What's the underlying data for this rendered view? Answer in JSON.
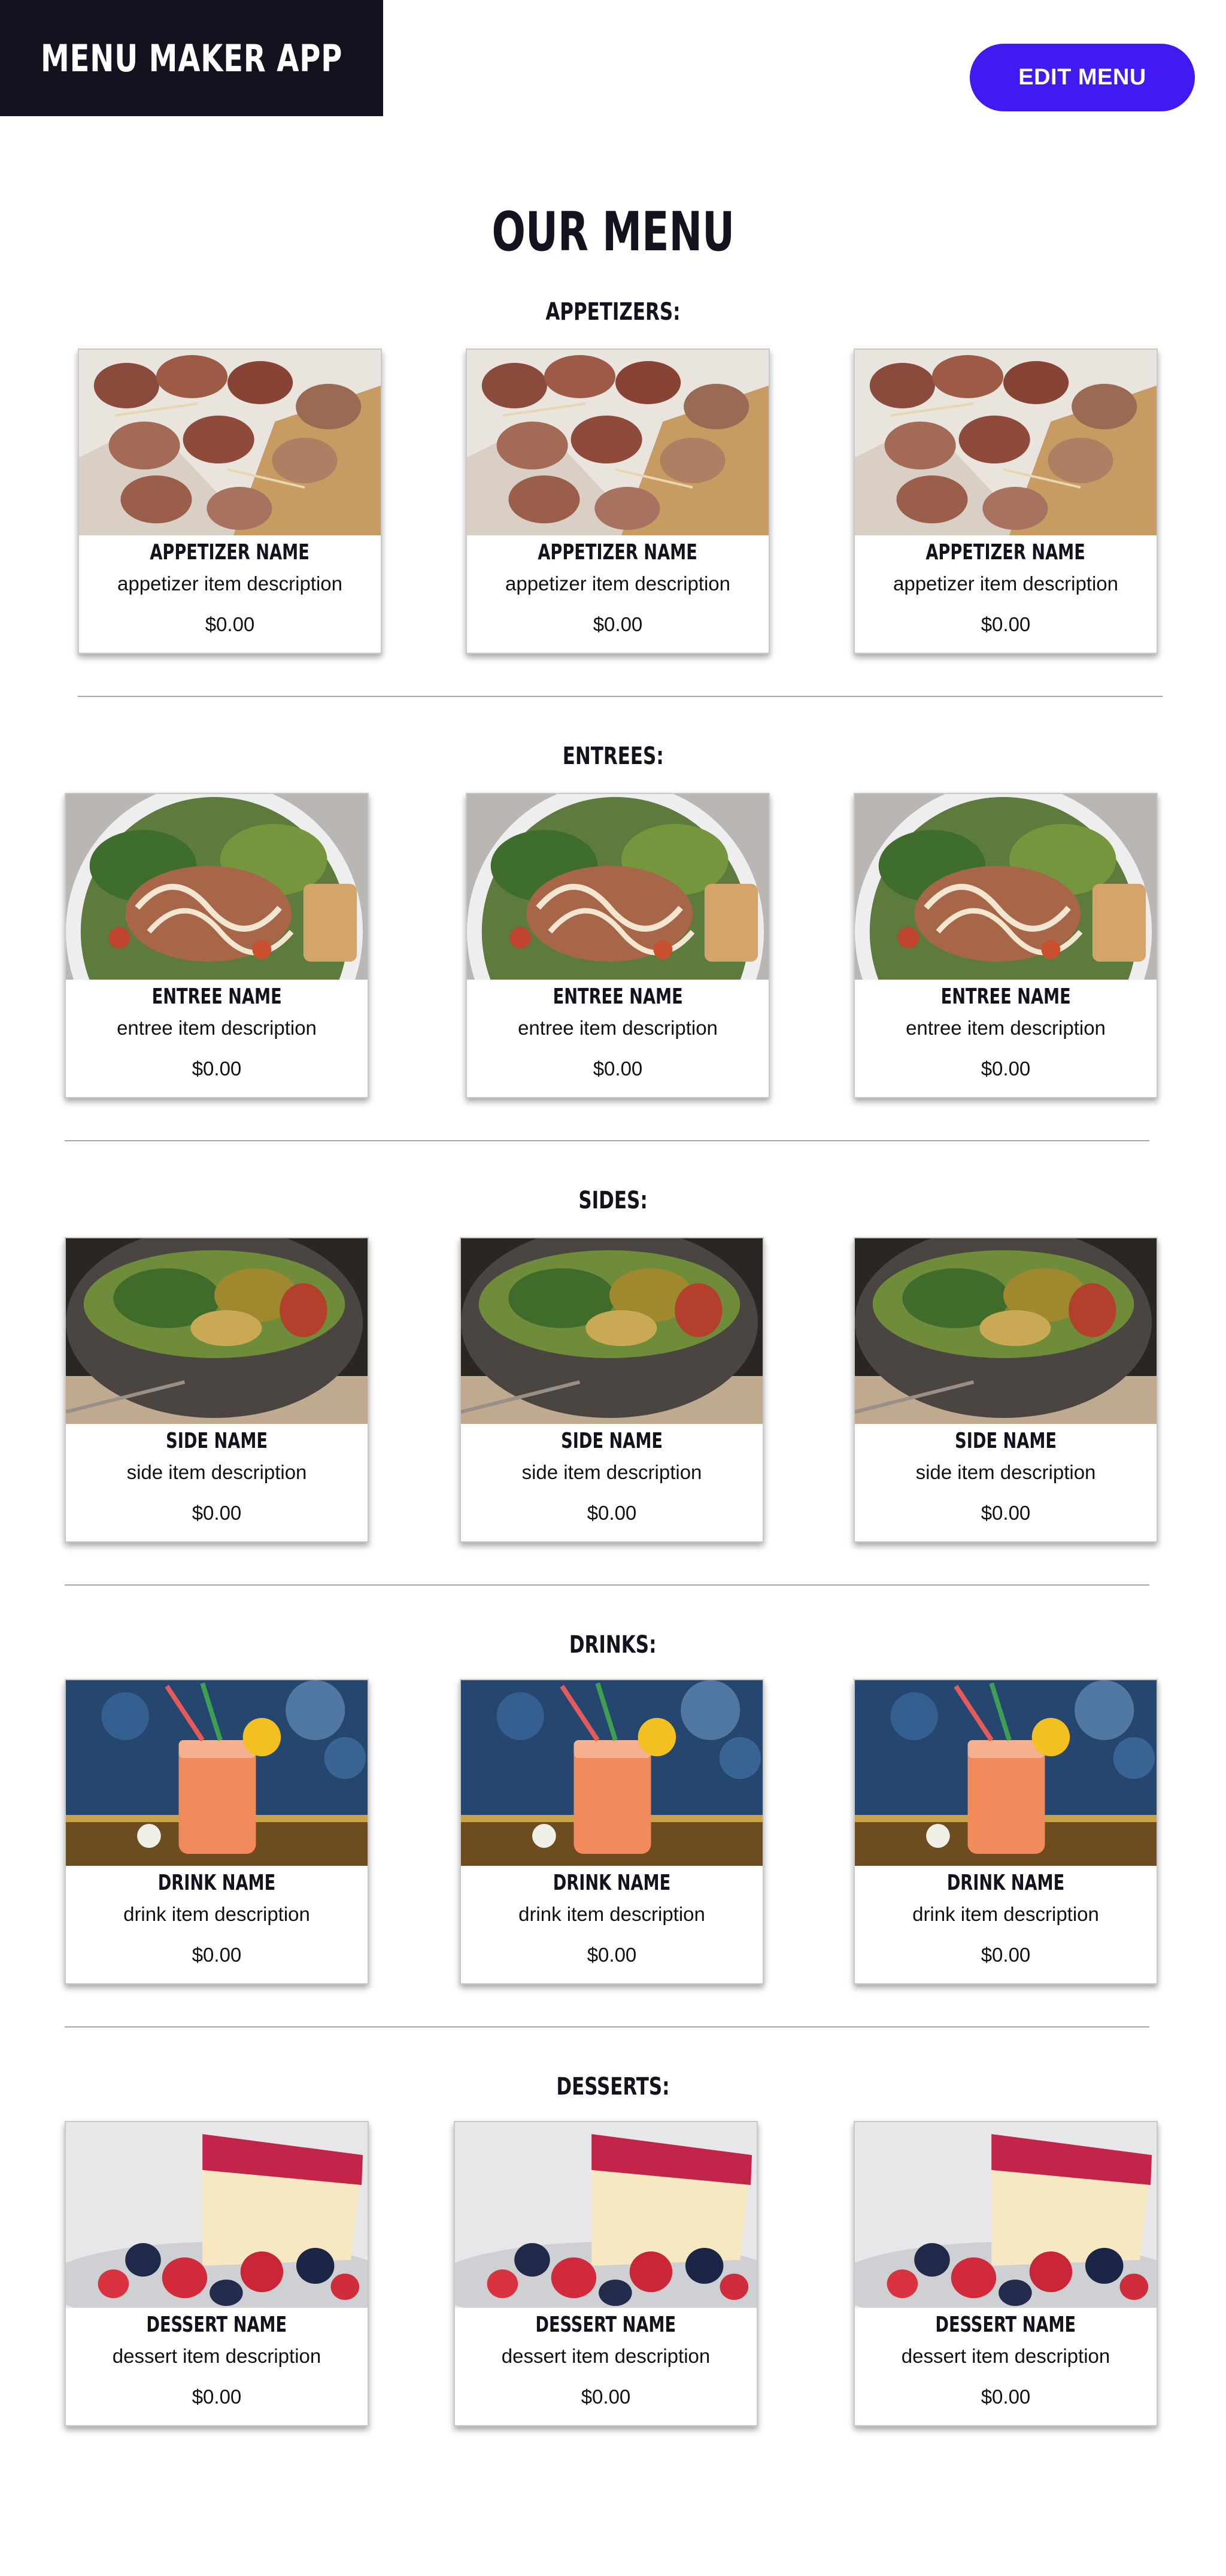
{
  "header": {
    "app_title": "MENU MAKER APP",
    "edit_button": "EDIT MENU"
  },
  "page_title": "OUR MENU",
  "colors": {
    "brand_bg": "#13121e",
    "accent": "#4219f0"
  },
  "sections": [
    {
      "title": "APPETIZERS:",
      "image": "bacon-wrapped-appetizer-photo",
      "items": [
        {
          "name": "APPETIZER NAME",
          "description": "appetizer item description",
          "price": "$0.00"
        },
        {
          "name": "APPETIZER NAME",
          "description": "appetizer item description",
          "price": "$0.00"
        },
        {
          "name": "APPETIZER NAME",
          "description": "appetizer item description",
          "price": "$0.00"
        }
      ]
    },
    {
      "title": "ENTREES:",
      "image": "caesar-salad-photo",
      "items": [
        {
          "name": "ENTREE NAME",
          "description": "entree item description",
          "price": "$0.00"
        },
        {
          "name": "ENTREE NAME",
          "description": "entree item description",
          "price": "$0.00"
        },
        {
          "name": "ENTREE NAME",
          "description": "entree item description",
          "price": "$0.00"
        }
      ]
    },
    {
      "title": "SIDES:",
      "image": "salad-bowl-photo",
      "items": [
        {
          "name": "SIDE NAME",
          "description": "side item description",
          "price": "$0.00"
        },
        {
          "name": "SIDE NAME",
          "description": "side item description",
          "price": "$0.00"
        },
        {
          "name": "SIDE NAME",
          "description": "side item description",
          "price": "$0.00"
        }
      ]
    },
    {
      "title": "DRINKS:",
      "image": "lemonade-jar-photo",
      "items": [
        {
          "name": "DRINK NAME",
          "description": "drink item description",
          "price": "$0.00"
        },
        {
          "name": "DRINK NAME",
          "description": "drink item description",
          "price": "$0.00"
        },
        {
          "name": "DRINK NAME",
          "description": "drink item description",
          "price": "$0.00"
        }
      ]
    },
    {
      "title": "DESSERTS:",
      "image": "cheesecake-photo",
      "items": [
        {
          "name": "DESSERT NAME",
          "description": "dessert item description",
          "price": "$0.00"
        },
        {
          "name": "DESSERT NAME",
          "description": "dessert item description",
          "price": "$0.00"
        },
        {
          "name": "DESSERT NAME",
          "description": "dessert item description",
          "price": "$0.00"
        }
      ]
    }
  ]
}
